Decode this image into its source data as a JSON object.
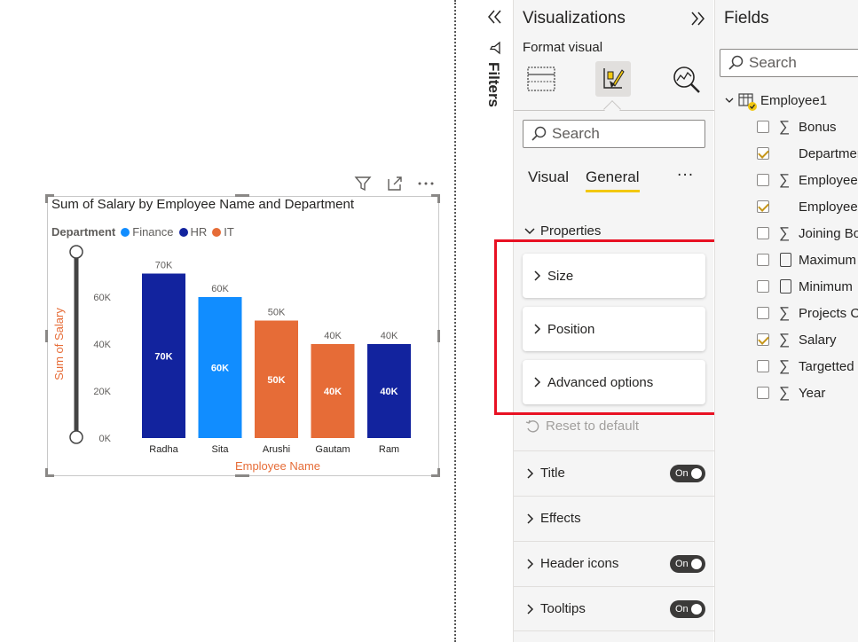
{
  "visual": {
    "title": "Sum of Salary by Employee Name and Department",
    "legend_title": "Department",
    "legend": [
      {
        "label": "Finance",
        "color": "#118dff"
      },
      {
        "label": "HR",
        "color": "#12239e"
      },
      {
        "label": "IT",
        "color": "#e66c37"
      }
    ],
    "y_axis_label": "Sum of Salary",
    "x_axis_label": "Employee Name"
  },
  "chart_data": {
    "type": "bar",
    "title": "Sum of Salary by Employee Name and Department",
    "xlabel": "Employee Name",
    "ylabel": "Sum of Salary",
    "categories": [
      "Radha",
      "Sita",
      "Arushi",
      "Gautam",
      "Ram"
    ],
    "values": [
      70000,
      60000,
      50000,
      40000,
      40000
    ],
    "departments": [
      "HR",
      "Finance",
      "IT",
      "IT",
      "HR"
    ],
    "colors": [
      "#12239e",
      "#118dff",
      "#e66c37",
      "#e66c37",
      "#12239e"
    ],
    "data_labels": [
      "70K",
      "60K",
      "50K",
      "40K",
      "40K"
    ],
    "y_ticks": [
      "0K",
      "20K",
      "40K",
      "60K"
    ],
    "y_tick_values": [
      0,
      20000,
      40000,
      60000
    ],
    "ylim": [
      0,
      80000
    ],
    "grid": false
  },
  "filters_pane": {
    "label": "Filters",
    "collapse_icon": "double-chevron-left-icon"
  },
  "viz_pane": {
    "title": "Visualizations",
    "subtitle": "Format visual",
    "search_placeholder": "Search",
    "tabs": [
      "Visual",
      "General"
    ],
    "active_tab": "General",
    "more_label": "···",
    "properties_label": "Properties",
    "cards": [
      "Size",
      "Position",
      "Advanced options"
    ],
    "reset_label": "Reset to default",
    "sections": [
      {
        "label": "Title",
        "toggle": "On"
      },
      {
        "label": "Effects",
        "toggle": ""
      },
      {
        "label": "Header icons",
        "toggle": "On"
      },
      {
        "label": "Tooltips",
        "toggle": "On"
      }
    ],
    "highlight_color": "#e81123",
    "accent_color": "#f2c811"
  },
  "fields_pane": {
    "title": "Fields",
    "search_placeholder": "Search",
    "table_name": "Employee1",
    "fields": [
      {
        "label": "Bonus",
        "checked": false,
        "icon": "sigma"
      },
      {
        "label": "Departmen",
        "checked": true,
        "icon": "none"
      },
      {
        "label": "Employee",
        "checked": false,
        "icon": "sigma"
      },
      {
        "label": "Employee",
        "checked": true,
        "icon": "none"
      },
      {
        "label": "Joining Bo",
        "checked": false,
        "icon": "sigma"
      },
      {
        "label": "Maximum",
        "checked": false,
        "icon": "calculator"
      },
      {
        "label": "Minimum",
        "checked": false,
        "icon": "calculator"
      },
      {
        "label": "Projects Co",
        "checked": false,
        "icon": "sigma"
      },
      {
        "label": "Salary",
        "checked": true,
        "icon": "sigma"
      },
      {
        "label": "Targetted",
        "checked": false,
        "icon": "sigma"
      },
      {
        "label": "Year",
        "checked": false,
        "icon": "sigma"
      }
    ]
  }
}
